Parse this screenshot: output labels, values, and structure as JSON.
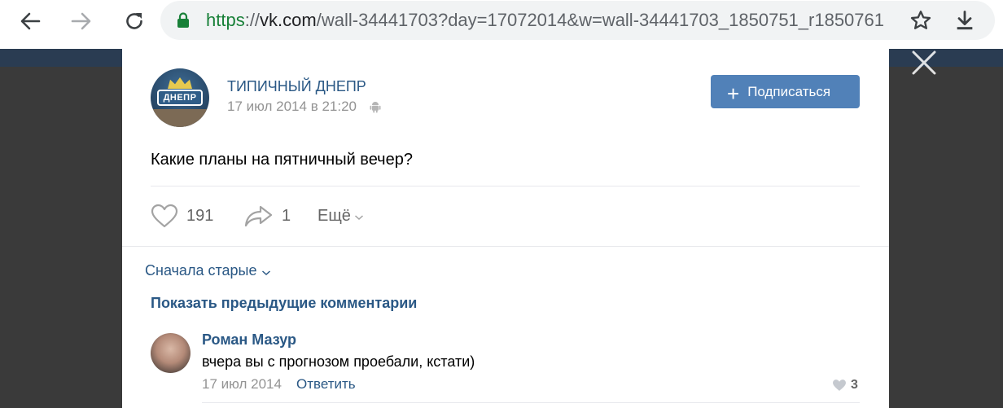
{
  "browser": {
    "url_scheme": "https",
    "url_sep": "://",
    "url_domain": "vk.com",
    "url_path": "/wall-34441703?day=17072014&w=wall-34441703_1850751_r1850761"
  },
  "post": {
    "group_name": "ТИПИЧНЫЙ ДНЕПР",
    "avatar_badge": "ДНЕПР",
    "date": "17 июл 2014 в 21:20",
    "subscribe_label": "Подписаться",
    "subscribe_plus": "+",
    "text": "Какие планы на пятничный вечер?",
    "likes": "191",
    "shares": "1",
    "more_label": "Ещё"
  },
  "comments": {
    "sort_label": "Сначала старые",
    "show_previous_label": "Показать предыдущие комментарии",
    "items": [
      {
        "author": "Роман Мазур",
        "text": "вчера вы с прогнозом проебали, кстати)",
        "date": "17 июл 2014",
        "reply_label": "Ответить",
        "likes": "3"
      }
    ]
  },
  "colors": {
    "link": "#2a5885",
    "button": "#5181b8",
    "overlay": "#3a3a3a",
    "secure_green": "#188038"
  }
}
